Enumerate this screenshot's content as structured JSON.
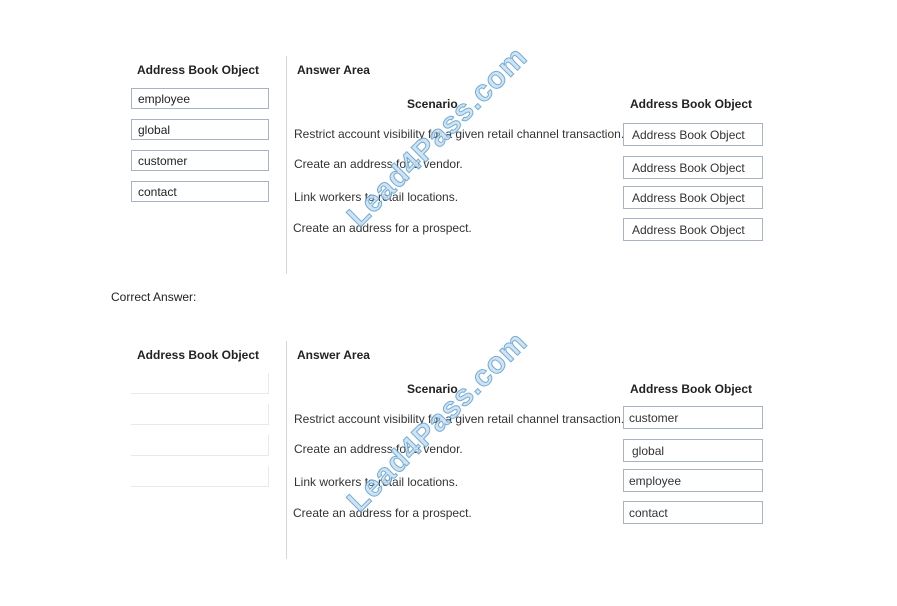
{
  "question": {
    "left_title": "Address Book Object",
    "answer_title": "Answer Area",
    "scenario_header": "Scenario",
    "object_header": "Address Book Object",
    "source_items": [
      "employee",
      "global",
      "customer",
      "contact"
    ],
    "scenarios": [
      "Restrict account visibility for a given retail channel transaction.",
      "Create an address for a vendor.",
      "Link workers to retail locations.",
      "Create an address for a prospect."
    ],
    "targets": [
      "Address Book Object",
      "Address Book Object",
      "Address Book Object",
      "Address Book Object"
    ]
  },
  "correct_label": "Correct Answer:",
  "answer": {
    "left_title": "Address Book Object",
    "answer_title": "Answer Area",
    "scenario_header": "Scenario",
    "object_header": "Address Book Object",
    "source_items": [
      "",
      "",
      "",
      ""
    ],
    "scenarios": [
      "Restrict account visibility for a given retail channel transaction.",
      "Create an address for a vendor.",
      "Link workers to retail locations.",
      "Create an address for a prospect."
    ],
    "targets": [
      "customer",
      "global",
      "employee",
      "contact"
    ]
  },
  "watermark": "Lead4Pass.com"
}
